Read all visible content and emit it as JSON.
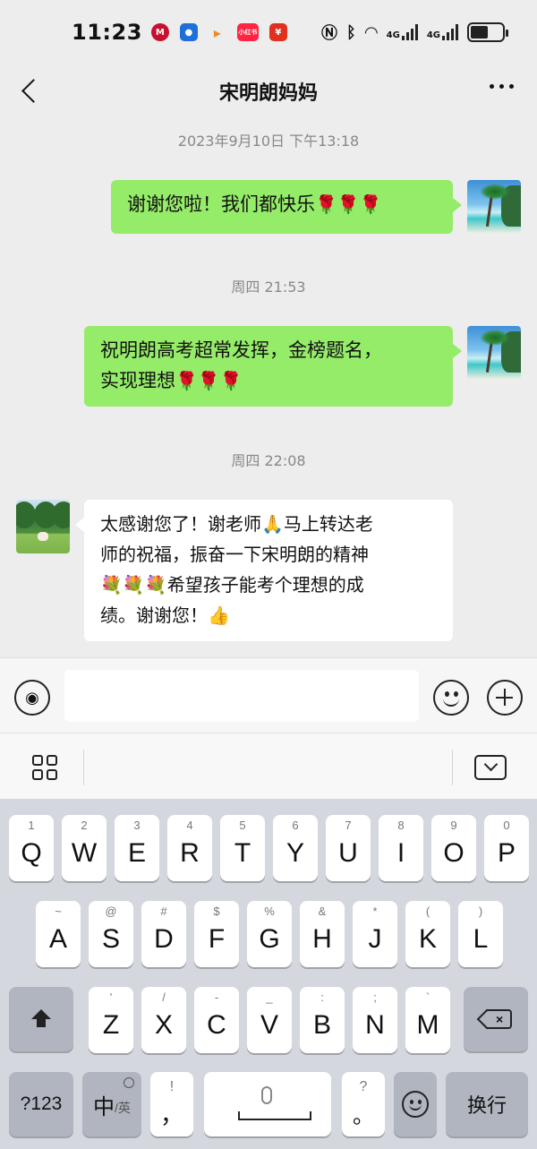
{
  "status": {
    "time": "11:23",
    "net_label_1": "4G",
    "net_label_2": "4G",
    "battery_level": 0.55,
    "notif_icons": [
      "metro-icon",
      "location-pin-icon",
      "play-icon",
      "xiaohongshu-icon",
      "red-packet-icon"
    ],
    "notif_texts": [
      "M",
      "",
      "▸",
      "小红书",
      "¥"
    ]
  },
  "header": {
    "title": "宋明朗妈妈"
  },
  "chat": {
    "ts1": "2023年9月10日 下午13:18",
    "msg1": "谢谢您啦！我们都快乐",
    "msg1_emoji": "🌹🌹🌹",
    "ts2": "周四 21:53",
    "msg2_line1": "祝明朗高考超常发挥，金榜题名，",
    "msg2_line2": "实现理想",
    "msg2_emoji": "🌹🌹🌹",
    "ts3": "周四 22:08",
    "msg3_line1": "太感谢您了！谢老师🙏马上转达老",
    "msg3_line2": "师的祝福，振奋一下宋明朗的精神",
    "msg3_line3": "💐💐💐希望孩子能考个理想的成",
    "msg3_line4": "绩。谢谢您！👍"
  },
  "input": {
    "placeholder": ""
  },
  "keyboard": {
    "row1": [
      {
        "hint": "1",
        "key": "Q"
      },
      {
        "hint": "2",
        "key": "W"
      },
      {
        "hint": "3",
        "key": "E"
      },
      {
        "hint": "4",
        "key": "R"
      },
      {
        "hint": "5",
        "key": "T"
      },
      {
        "hint": "6",
        "key": "Y"
      },
      {
        "hint": "7",
        "key": "U"
      },
      {
        "hint": "8",
        "key": "I"
      },
      {
        "hint": "9",
        "key": "O"
      },
      {
        "hint": "0",
        "key": "P"
      }
    ],
    "row2": [
      {
        "hint": "~",
        "key": "A"
      },
      {
        "hint": "@",
        "key": "S"
      },
      {
        "hint": "#",
        "key": "D"
      },
      {
        "hint": "$",
        "key": "F"
      },
      {
        "hint": "%",
        "key": "G"
      },
      {
        "hint": "&",
        "key": "H"
      },
      {
        "hint": "*",
        "key": "J"
      },
      {
        "hint": "(",
        "key": "K"
      },
      {
        "hint": ")",
        "key": "L"
      }
    ],
    "row3": [
      {
        "hint": "'",
        "key": "Z"
      },
      {
        "hint": "/",
        "key": "X"
      },
      {
        "hint": "-",
        "key": "C"
      },
      {
        "hint": "_",
        "key": "V"
      },
      {
        "hint": ":",
        "key": "B"
      },
      {
        "hint": ";",
        "key": "N"
      },
      {
        "hint": "`",
        "key": "M"
      }
    ],
    "num_key": "?123",
    "lang_main": "中",
    "lang_sub": "/英",
    "comma_hint": "!",
    "comma": "，",
    "period_hint": "?",
    "period": "。",
    "enter": "换行"
  }
}
